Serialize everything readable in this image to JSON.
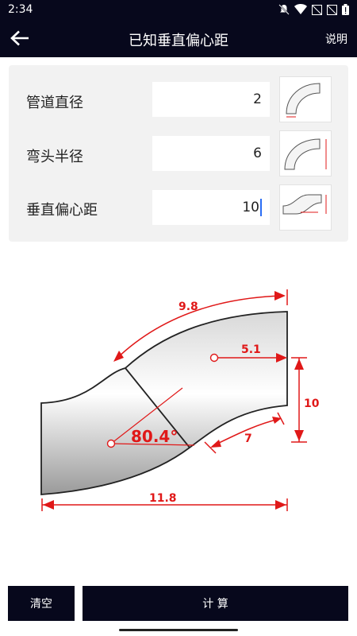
{
  "status": {
    "time": "2:34"
  },
  "app_bar": {
    "title": "已知垂直偏心距",
    "help": "说明"
  },
  "inputs": [
    {
      "label": "管道直径",
      "value": "2"
    },
    {
      "label": "弯头半径",
      "value": "6"
    },
    {
      "label": "垂直偏心距",
      "value": "10"
    }
  ],
  "diagram": {
    "arc_length_outer": "9.8",
    "horizontal_offset": "5.1",
    "vertical_offset": "10",
    "arc_length_inner": "7",
    "angle": "80.4°",
    "total_length": "11.8"
  },
  "buttons": {
    "clear": "清空",
    "calculate": "计 算"
  },
  "colors": {
    "bar": "#07081c",
    "dimension": "#e01818"
  }
}
